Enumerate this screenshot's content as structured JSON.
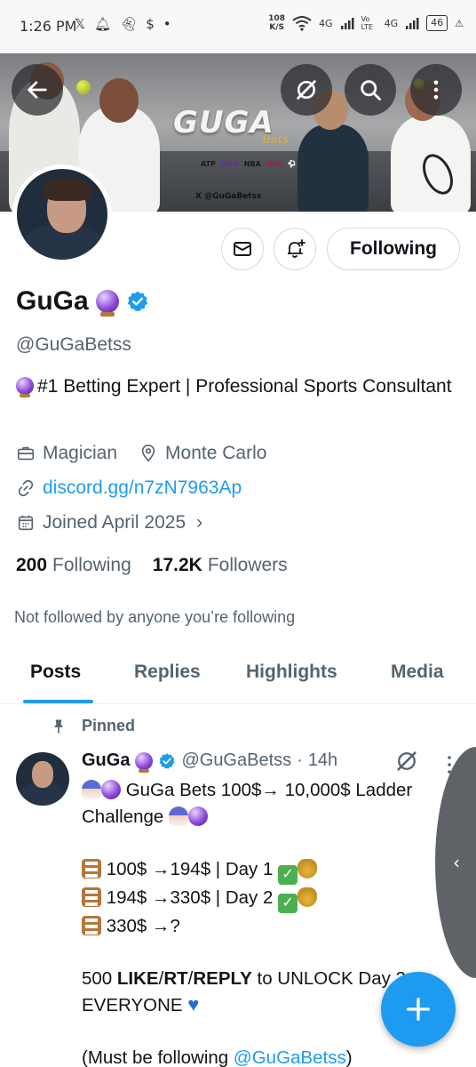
{
  "status_bar": {
    "time": "1:26 PM",
    "left_icons": [
      "x-logo",
      "notification-bell",
      "snapchat-ghost",
      "dollar-app",
      "dot"
    ],
    "speed": "108",
    "speed_unit": "K/S",
    "net1": "4G",
    "net2": "Vo LTE",
    "net3": "4G",
    "battery": "46"
  },
  "banner": {
    "logo_text": "GUGA",
    "logo_sub": "Bets",
    "leagues": [
      "ATP",
      "WTA",
      "NBA",
      "UFC",
      "⚽"
    ],
    "handle_text": "X @GuGaBetss"
  },
  "header_buttons": {
    "back": "back-arrow-icon",
    "grok": "grok-icon",
    "search": "search-icon",
    "more": "more-vertical-icon"
  },
  "profile": {
    "display_name": "GuGa",
    "handle": "@GuGaBetss",
    "bio": "#1 Betting Expert | Professional Sports Consultant",
    "profession": "Magician",
    "location": "Monte Carlo",
    "link": "discord.gg/n7zN7963Ap",
    "joined": "Joined April 2025",
    "following_count": "200",
    "following_label": "Following",
    "followers_count": "17.2K",
    "followers_label": "Followers",
    "not_followed": "Not followed by anyone you’re following"
  },
  "actions": {
    "following_button": "Following"
  },
  "tabs": [
    {
      "label": "Posts",
      "active": true
    },
    {
      "label": "Replies",
      "active": false
    },
    {
      "label": "Highlights",
      "active": false
    },
    {
      "label": "Media",
      "active": false
    }
  ],
  "pinned_post": {
    "pinned_label": "Pinned",
    "author": "GuGa",
    "handle": "@GuGaBetss",
    "separator": "·",
    "time": "14h",
    "line1_text": " GuGa Bets 100$→ 10,000$ Ladder Challenge ",
    "day1": " 100$ →194$ | Day 1 ",
    "day2": " 194$ →330$ | Day 2 ",
    "day3": " 330$ →?",
    "unlock_pre": "500 ",
    "like": "LIKE",
    "slash1": "/",
    "rt": "RT",
    "slash2": "/",
    "reply": "REPLY",
    "unlock_post": " to UNLOCK Day 3 to EVERYONE ",
    "must_pre": "(Must be following ",
    "must_mention": "@GuGaBetss",
    "must_post": ")"
  },
  "colors": {
    "accent": "#1d9bf0",
    "text_primary": "#0f1419",
    "text_secondary": "#536471"
  }
}
